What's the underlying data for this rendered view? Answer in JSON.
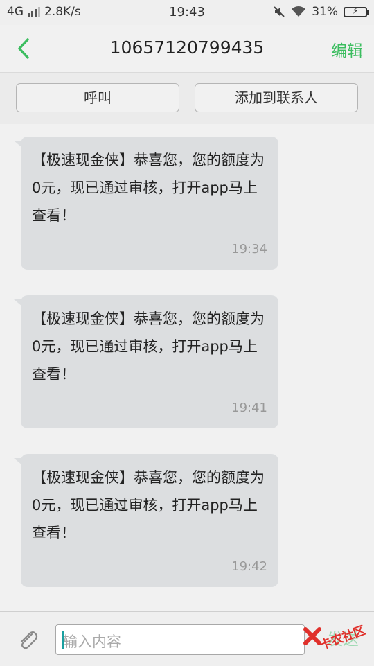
{
  "status_bar": {
    "network": "4G",
    "speed": "2.8K/s",
    "time": "19:43",
    "battery_percent": "31%",
    "icons": [
      "signal-icon",
      "mute-icon",
      "wifi-icon",
      "battery-icon"
    ]
  },
  "header": {
    "title": "10657120799435",
    "edit_label": "编辑",
    "back_icon": "chevron-left-icon",
    "accent_color": "#3bbd5f"
  },
  "actions": {
    "call_label": "呼叫",
    "add_contact_label": "添加到联系人"
  },
  "messages": [
    {
      "text": "【极速现金侠】恭喜您，您的额度为0元，现已通过审核，打开app马上查看！",
      "time": "19:34"
    },
    {
      "text": "【极速现金侠】恭喜您，您的额度为0元，现已通过审核，打开app马上查看！",
      "time": "19:41"
    },
    {
      "text": "【极速现金侠】恭喜您，您的额度为0元，现已通过审核，打开app马上查看！",
      "time": "19:42"
    }
  ],
  "composer": {
    "placeholder": "输入内容",
    "send_label": "发送",
    "attach_icon": "paperclip-icon"
  },
  "watermark": {
    "text": "卡农社区"
  }
}
